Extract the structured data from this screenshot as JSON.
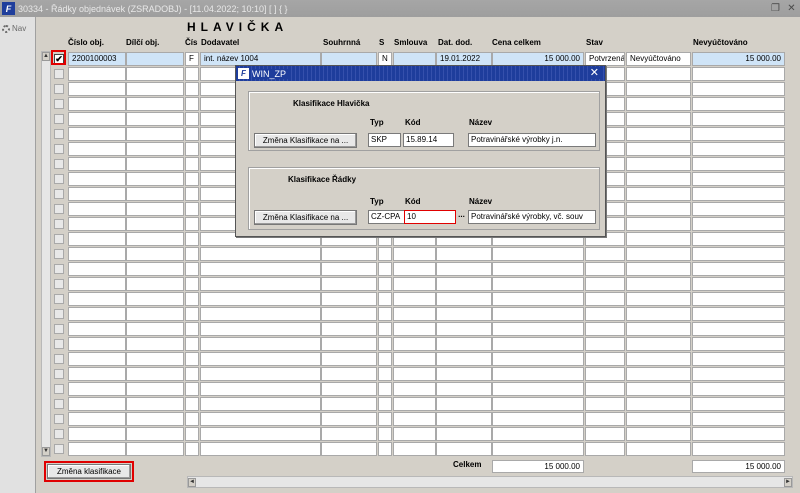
{
  "window": {
    "title": "30334 - Řádky objednávek (ZSRADOBJ) - [11.04.2022; 10:10]  [ ] { }",
    "icon_text": "F"
  },
  "nav": {
    "label": "Nav"
  },
  "section": {
    "title": "HLAVIČKA"
  },
  "columns": {
    "cislo_obj": "Číslo obj.",
    "dilci_obj": "Dílčí obj.",
    "cis": "Čís",
    "dodavatel": "Dodavatel",
    "souhrnna": "Souhrnná",
    "s": "S",
    "smlouva": "Smlouva",
    "dat_dod": "Dat. dod.",
    "cena_celkem": "Cena celkem",
    "stav": "Stav",
    "nevyuctovano": "Nevyúčtováno"
  },
  "row": {
    "checked": "✔",
    "cislo_obj": "2200100003",
    "dilci_obj": "",
    "cis": "F",
    "dodavatel": "int. název 1004",
    "souhrnna": "",
    "s": "N",
    "smlouva": "",
    "dat_dod": "19.01.2022",
    "cena_celkem": "15 000.00",
    "stav": "Potvrzená",
    "stav2": "Nevyúčtováno",
    "nevyuctovano": "15 000.00"
  },
  "totals": {
    "label": "Celkem",
    "cena_celkem": "15 000.00",
    "nevyuctovano": "15 000.00"
  },
  "buttons": {
    "zmena_klasifikace": "Změna klasifikace"
  },
  "dialog": {
    "title": "WIN_ZP",
    "header_group": {
      "title": "Klasifikace Hlavička",
      "typ_label": "Typ",
      "kod_label": "Kód",
      "nazev_label": "Název",
      "button": "Změna Klasifikace na ...",
      "typ": "SKP",
      "kod": "15.89.14",
      "nazev": "Potravinářské výrobky j.n."
    },
    "row_group": {
      "title": "Klasifikace Řádky",
      "typ_label": "Typ",
      "kod_label": "Kód",
      "nazev_label": "Název",
      "button": "Změna Klasifikace na ...",
      "typ": "CZ-CPA",
      "kod": "10",
      "lookup": "...",
      "nazev": "Potravinářské výrobky, vč. souv"
    }
  }
}
